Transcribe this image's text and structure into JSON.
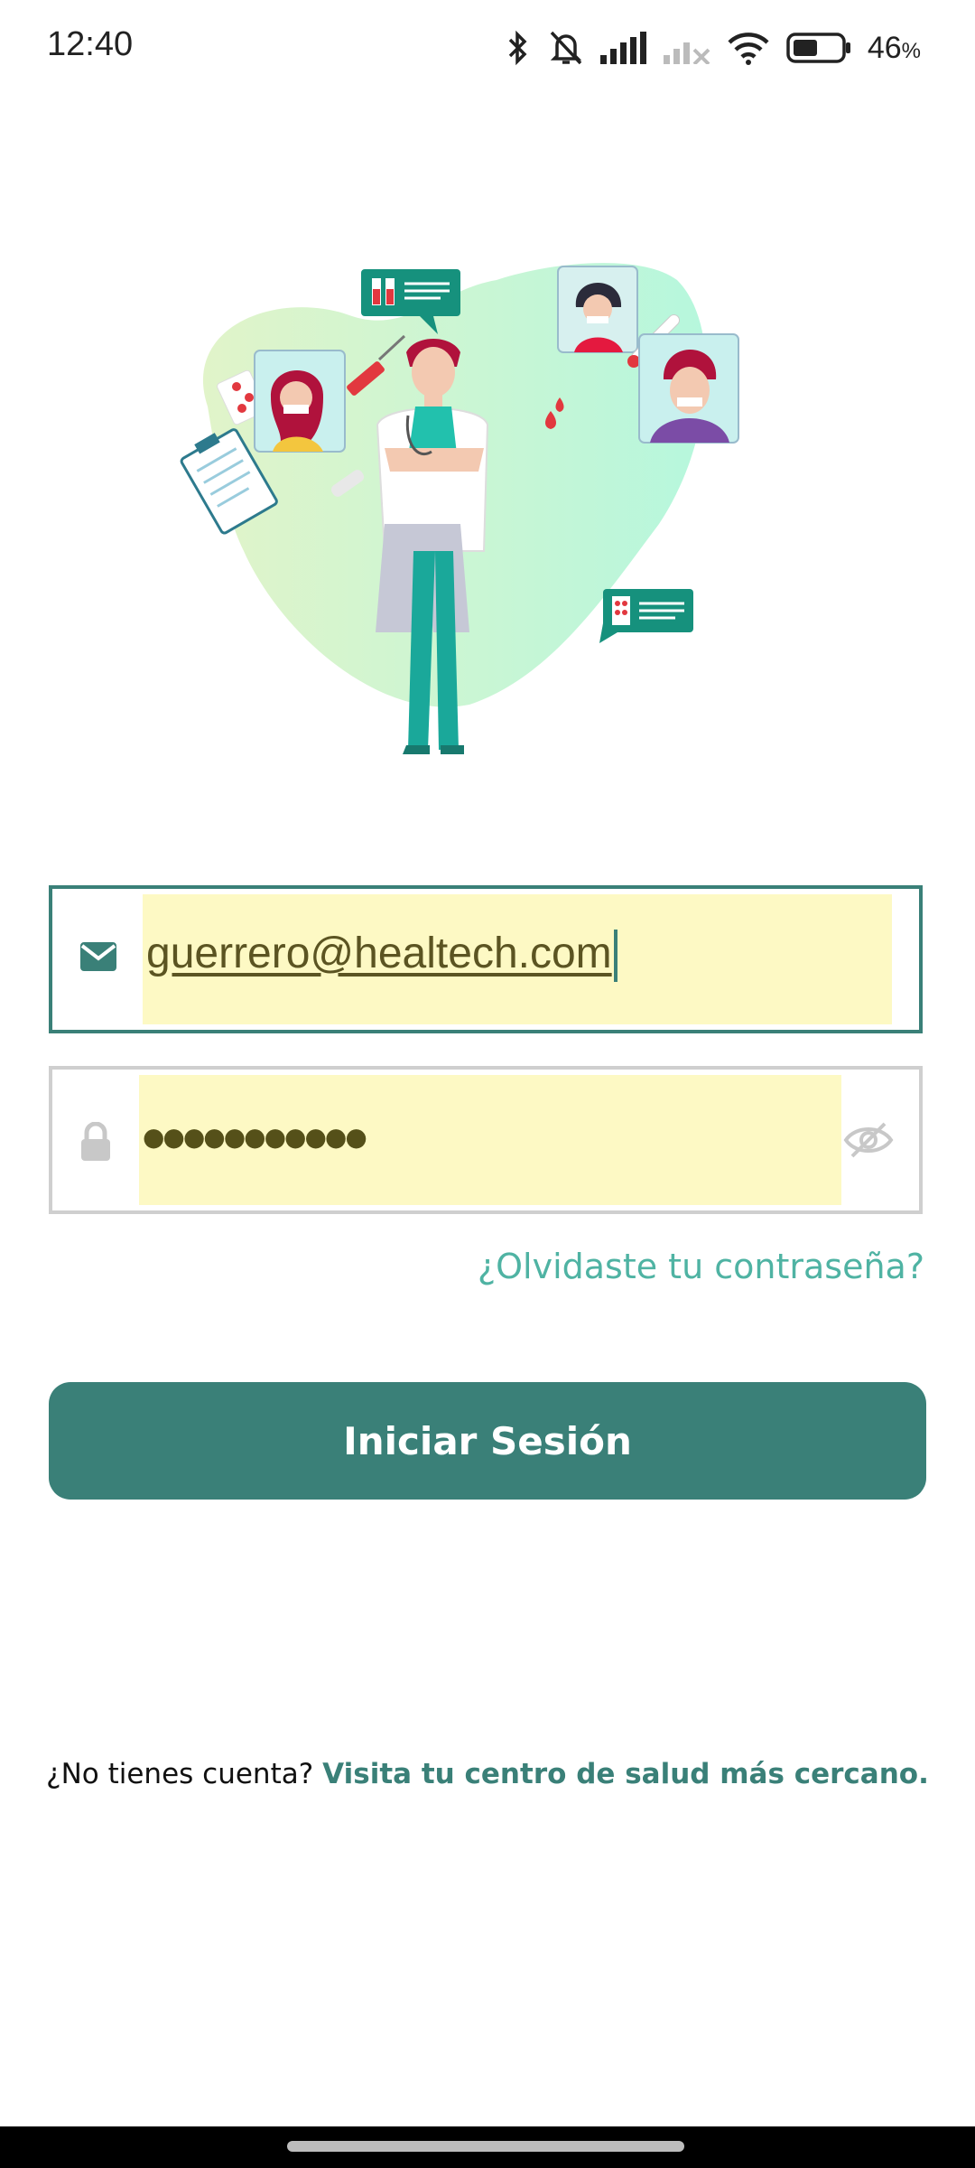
{
  "status_bar": {
    "time": "12:40",
    "battery_percent": "46",
    "battery_unit": "%",
    "icons": [
      "bluetooth-icon",
      "bell-off-icon",
      "signal-icon",
      "signal-off-icon",
      "wifi-icon",
      "battery-icon"
    ]
  },
  "login": {
    "email_value": "guerrero@healtech.com",
    "password_mask": "●●●●●●●●●●●",
    "forgot_password": "¿Olvidaste tu contraseña?",
    "submit_label": "Iniciar Sesión"
  },
  "signup": {
    "prompt": "¿No tienes cuenta?",
    "link": "Visita tu centro de salud más cercano."
  },
  "colors": {
    "primary": "#3a8078",
    "link_light": "#4fb3a3",
    "autofill": "#fdf9c4",
    "blob": "#c9f3dc"
  }
}
